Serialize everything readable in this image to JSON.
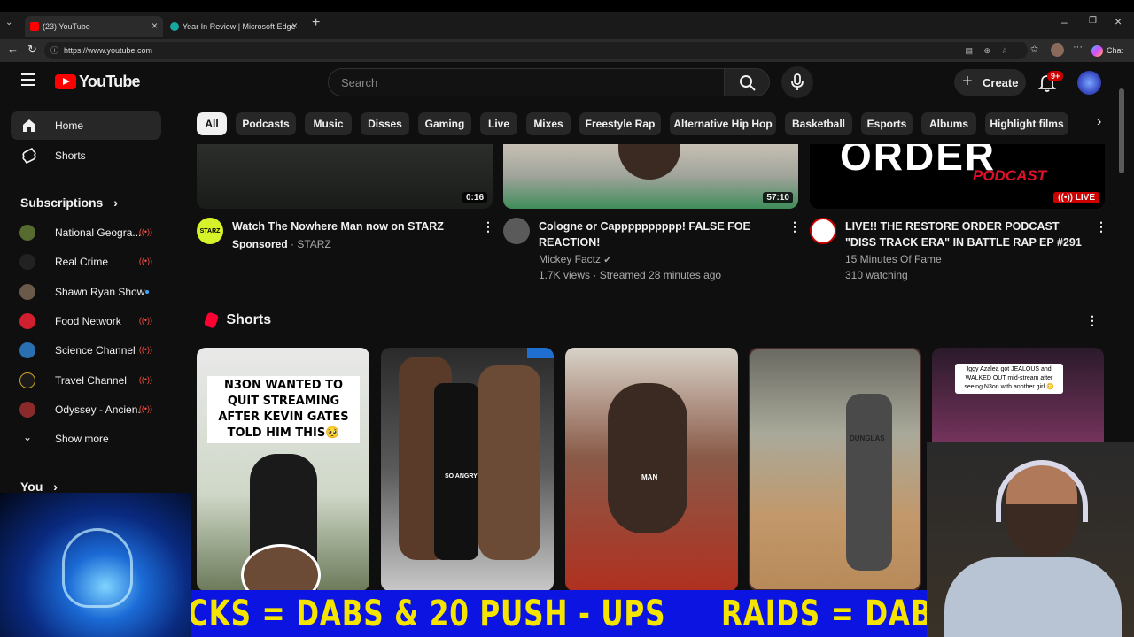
{
  "browser": {
    "tabs": [
      {
        "title": "(23) YouTube",
        "active": true
      },
      {
        "title": "Year In Review | Microsoft Edge",
        "active": false
      }
    ],
    "url": "https://www.youtube.com",
    "chat_label": "Chat"
  },
  "header": {
    "logo_text": "YouTube",
    "search_placeholder": "Search",
    "create_label": "Create",
    "notifications_badge": "9+"
  },
  "chips": [
    "All",
    "Podcasts",
    "Music",
    "Disses",
    "Gaming",
    "Live",
    "Mixes",
    "Freestyle Rap",
    "Alternative Hip Hop",
    "Basketball",
    "Esports",
    "Albums",
    "Highlight films"
  ],
  "sidebar": {
    "home": "Home",
    "shorts": "Shorts",
    "subscriptions_heading": "Subscriptions",
    "subscriptions": [
      {
        "name": "National Geogra...",
        "status": "live"
      },
      {
        "name": "Real Crime",
        "status": "live"
      },
      {
        "name": "Shawn Ryan Show",
        "status": "new"
      },
      {
        "name": "Food Network",
        "status": "live"
      },
      {
        "name": "Science Channel",
        "status": "live"
      },
      {
        "name": "Travel Channel",
        "status": "live"
      },
      {
        "name": "Odyssey - Ancien...",
        "status": "live"
      }
    ],
    "show_more": "Show more",
    "you_heading": "You"
  },
  "videos": [
    {
      "title": "Watch The Nowhere Man now on STARZ",
      "sponsored": "Sponsored",
      "channel": "STARZ",
      "duration": "0:16",
      "avatar_text": "STARZ"
    },
    {
      "title": "Cologne or Capppppppppp! FALSE FOE REACTION!",
      "channel": "Mickey Factz",
      "meta": "1.7K views · Streamed 28 minutes ago",
      "duration": "57:10"
    },
    {
      "title": "LIVE!! THE RESTORE ORDER PODCAST \"DISS TRACK ERA\" IN BATTLE RAP EP #291",
      "channel": "15 Minutes Of Fame",
      "meta": "310 watching",
      "badge": "LIVE",
      "thumb_text": "ORDER",
      "thumb_sub": "PODCAST"
    }
  ],
  "shorts_section": {
    "heading": "Shorts",
    "cards": [
      {
        "caption": "N3ON WANTED TO QUIT STREAMING AFTER KEVIN GATES TOLD HIM THIS🥺"
      },
      {
        "caption": "SO ANGRY"
      },
      {
        "caption": "MAN"
      },
      {
        "caption": "DUNGLAS"
      },
      {
        "caption": "Iggy Azalea got JEALOUS and WALKED OUT mid-stream after seeing N3on with another girl 😳"
      }
    ]
  },
  "overlay": {
    "ticker_left": "CKS = DABS & 20 PUSH - UPS",
    "ticker_right": "RAIDS = DABS"
  },
  "colors": {
    "accent": "#ff0000",
    "live": "#cc0000",
    "ticker_bg": "#0b14e0",
    "ticker_text": "#f5e400"
  }
}
